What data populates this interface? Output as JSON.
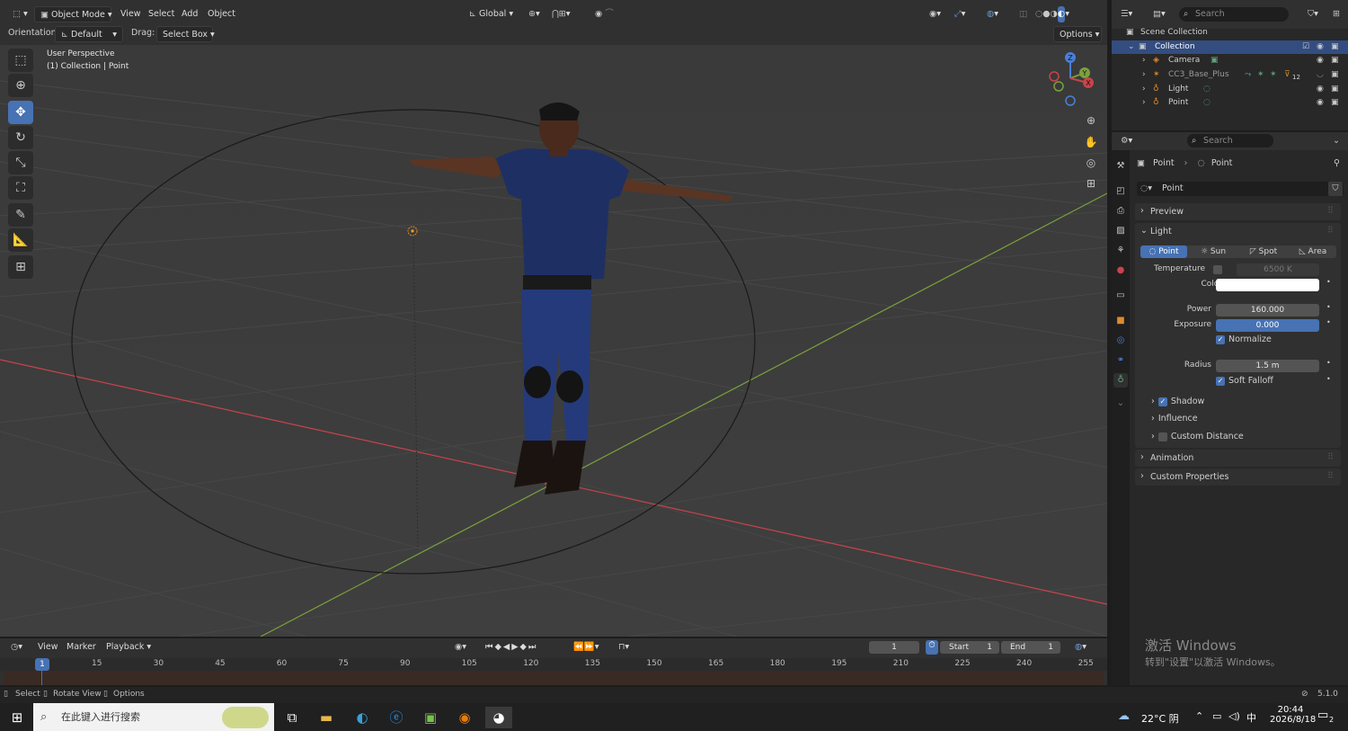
{
  "header": {
    "mode": "Object Mode",
    "menus": [
      "View",
      "Select",
      "Add",
      "Object"
    ],
    "transform": "Global",
    "orientation_label": "Orientation:",
    "orientation_value": "Default",
    "drag_label": "Drag:",
    "drag_value": "Select Box",
    "options": "Options"
  },
  "viewport": {
    "title": "User Perspective",
    "subtitle": "(1) Collection | Point",
    "gizmo": {
      "z": "Z",
      "y": "Y",
      "x": "X"
    }
  },
  "outliner": {
    "search_placeholder": "Search",
    "scene_collection": "Scene Collection",
    "collection": "Collection",
    "items": [
      {
        "label": "Camera"
      },
      {
        "label": "CC3_Base_Plus"
      },
      {
        "label": "Light"
      },
      {
        "label": "Point"
      }
    ],
    "cc3_badge": "12"
  },
  "properties": {
    "search_placeholder": "Search",
    "breadcrumb_object": "Point",
    "breadcrumb_data": "Point",
    "datablock_name": "Point",
    "preview": "Preview",
    "light_section": "Light",
    "light_types": [
      "Point",
      "Sun",
      "Spot",
      "Area"
    ],
    "temperature_label": "Temperature",
    "temperature_value": "6500 K",
    "color_label": "Color",
    "color_value": "#ffffff",
    "power_label": "Power",
    "power_value": "160.000",
    "exposure_label": "Exposure",
    "exposure_value": "0.000",
    "normalize": "Normalize",
    "radius_label": "Radius",
    "radius_value": "1.5 m",
    "soft_falloff": "Soft Falloff",
    "shadow": "Shadow",
    "influence": "Influence",
    "custom_distance": "Custom Distance",
    "animation": "Animation",
    "custom_properties": "Custom Properties"
  },
  "timeline": {
    "menus": [
      "View",
      "Marker",
      "Playback"
    ],
    "current_frame": "1",
    "start_label": "Start",
    "start_value": "1",
    "end_label": "End",
    "end_value": "1",
    "playhead": "1",
    "ticks": [
      "15",
      "30",
      "45",
      "60",
      "75",
      "90",
      "105",
      "120",
      "135",
      "150",
      "165",
      "180",
      "195",
      "210",
      "225",
      "240",
      "255"
    ]
  },
  "statusbar": {
    "select": "Select",
    "rotate": "Rotate View",
    "options": "Options",
    "version": "5.1.0"
  },
  "watermark": {
    "line1": "激活 Windows",
    "line2": "转到\"设置\"以激活 Windows。"
  },
  "taskbar": {
    "search_placeholder": "在此键入进行搜索",
    "weather": "22°C 阴",
    "ime": "中",
    "time": "20:44",
    "date": "2026/8/18",
    "notif_count": "2"
  },
  "colors": {
    "accent": "#4772b3",
    "x_axis": "#c9434a",
    "y_axis": "#7aa13b",
    "viewport_bg": "#3c3c3c"
  }
}
